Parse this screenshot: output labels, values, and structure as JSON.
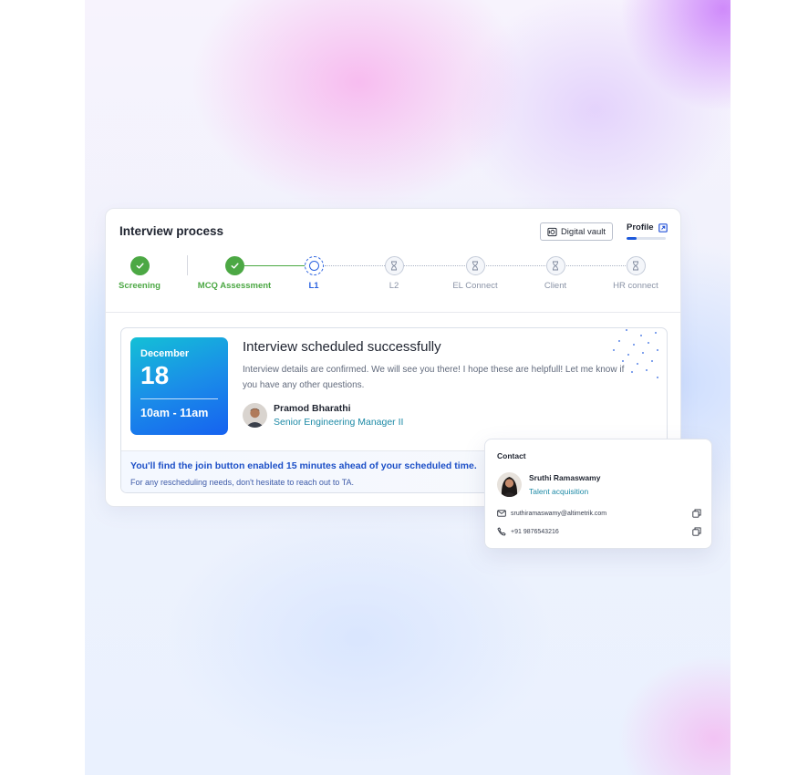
{
  "card": {
    "title": "Interview process",
    "digital_vault_label": "Digital vault",
    "profile_label": "Profile",
    "profile_progress": 0.25
  },
  "steps": [
    {
      "label": "Screening",
      "status": "done"
    },
    {
      "label": "MCQ Assessment",
      "status": "done"
    },
    {
      "label": "L1",
      "status": "current"
    },
    {
      "label": "L2",
      "status": "pending"
    },
    {
      "label": "EL Connect",
      "status": "pending"
    },
    {
      "label": "Client",
      "status": "pending"
    },
    {
      "label": "HR connect",
      "status": "pending"
    }
  ],
  "schedule": {
    "month": "December",
    "day": "18",
    "time": "10am - 11am",
    "title": "Interview scheduled successfully",
    "description": "Interview details are confirmed. We will see you there! I hope these are helpfull! Let me know if you have any other questions.",
    "interviewer_name": "Pramod Bharathi",
    "interviewer_role": "Senior Engineering Manager II",
    "notice_main": "You'll find the join button enabled 15 minutes ahead of your scheduled time.",
    "notice_sub": "For any rescheduling needs, don't hesitate to reach out to TA."
  },
  "contact": {
    "header": "Contact",
    "name": "Sruthi Ramaswamy",
    "role": "Talent acquisition",
    "email": "sruthiramaswamy@altimetrik.com",
    "phone": "+91 9876543216"
  },
  "colors": {
    "done": "#4ca844",
    "current": "#2a62e0",
    "pending": "#8a93a6",
    "accent_teal": "#1d8aa6"
  },
  "icons": {
    "done": "check-icon",
    "current": "in-progress-icon",
    "pending": "hourglass-icon"
  }
}
